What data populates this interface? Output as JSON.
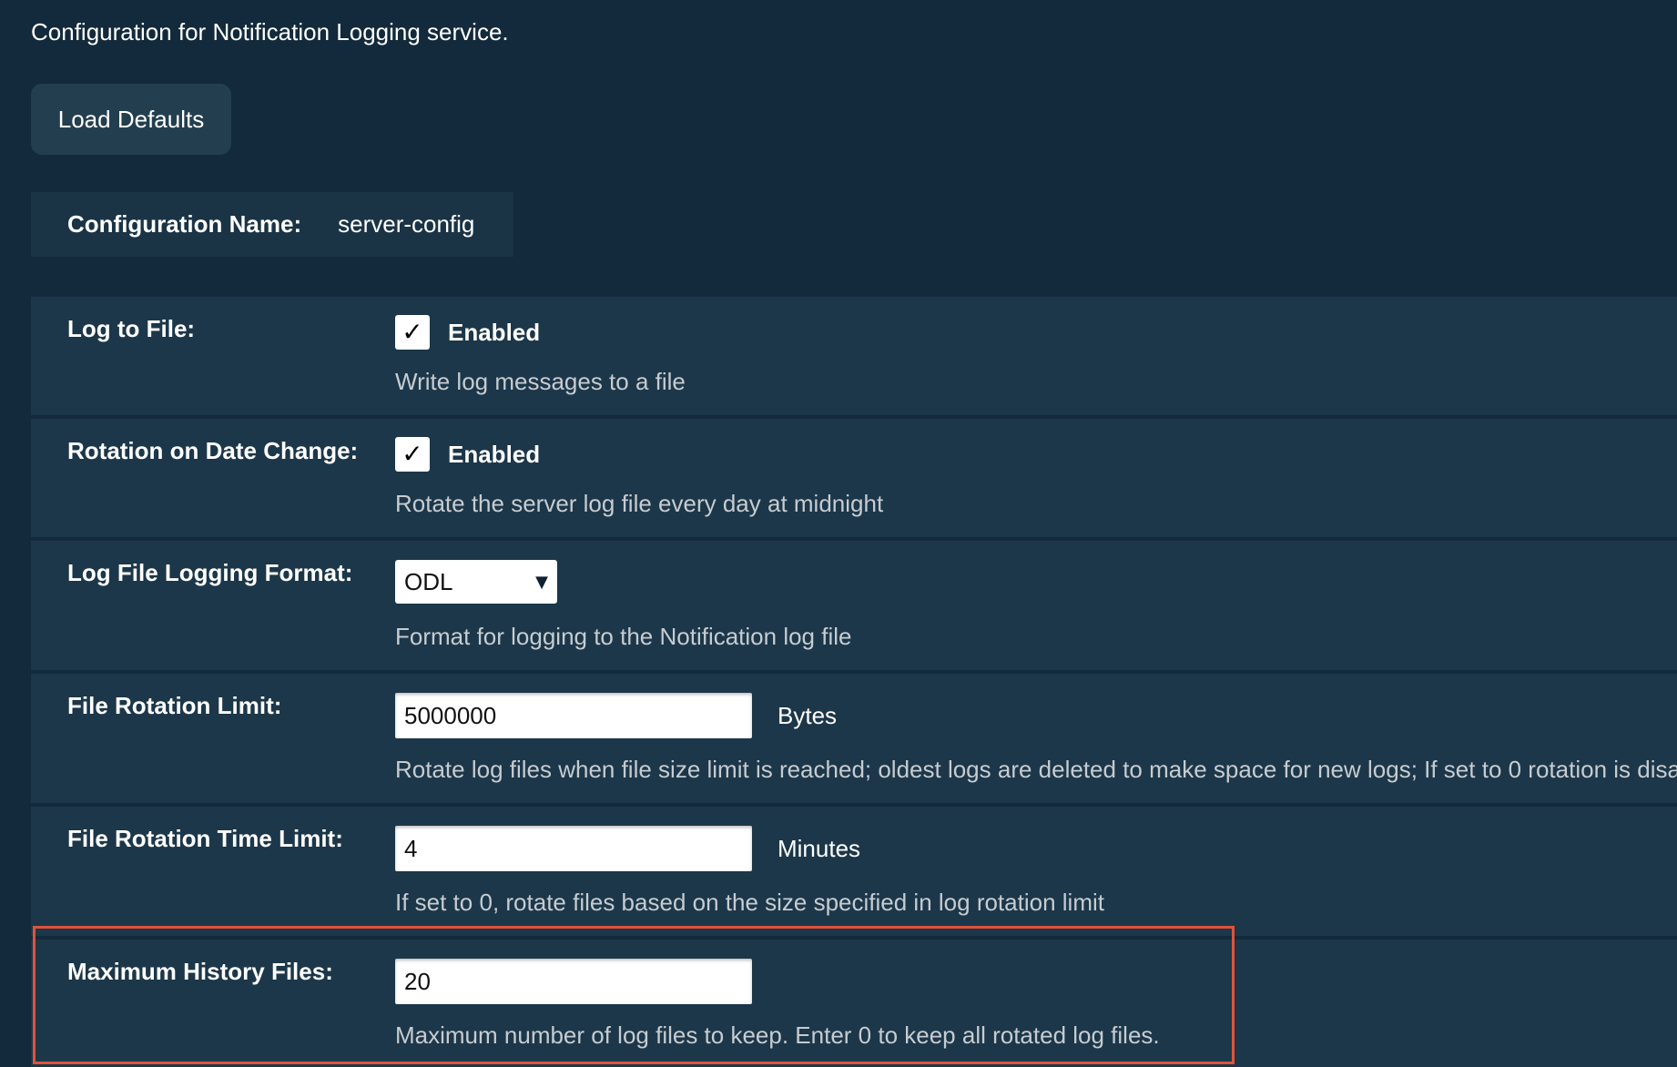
{
  "intro_text": "Configuration for Notification Logging service.",
  "load_defaults_label": "Load Defaults",
  "config_name": {
    "label": "Configuration Name:",
    "value": "server-config"
  },
  "settings": {
    "log_to_file": {
      "label": "Log to File:",
      "checked_glyph": "✓",
      "checkbox_label": "Enabled",
      "description": "Write log messages to a file"
    },
    "rotation_on_date_change": {
      "label": "Rotation on Date Change:",
      "checked_glyph": "✓",
      "checkbox_label": "Enabled",
      "description": "Rotate the server log file every day at midnight"
    },
    "log_file_logging_format": {
      "label": "Log File Logging Format:",
      "selected": "ODL",
      "arrow_glyph": "▼",
      "description": "Format for logging to the Notification log file"
    },
    "file_rotation_limit": {
      "label": "File Rotation Limit:",
      "value": "5000000",
      "unit": "Bytes",
      "description": "Rotate log files when file size limit is reached; oldest logs are deleted to make space for new logs; If set to 0 rotation is disa"
    },
    "file_rotation_time_limit": {
      "label": "File Rotation Time Limit:",
      "value": "4",
      "unit": "Minutes",
      "description": "If set to 0, rotate files based on the size specified in log rotation limit"
    },
    "maximum_history_files": {
      "label": "Maximum History Files:",
      "value": "20",
      "description": "Maximum number of log files to keep. Enter 0 to keep all rotated log files."
    }
  },
  "colors": {
    "page_background": "#122a3b",
    "row_background": "#1c3749",
    "button_background": "#233f4f",
    "highlight_border": "#e0533a",
    "description_text": "#c6ccd1"
  }
}
